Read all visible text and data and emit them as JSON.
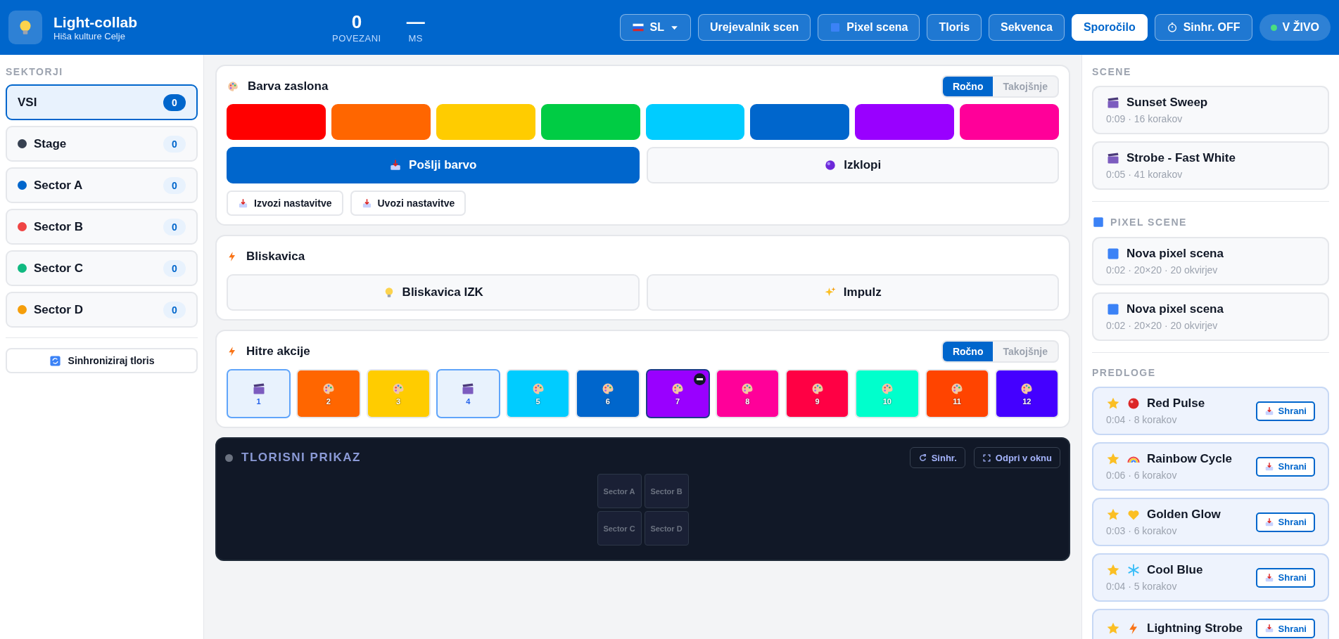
{
  "header": {
    "title": "Light-collab",
    "subtitle": "Hiša kulture Celje",
    "stats": [
      {
        "value": "0",
        "label": "POVEZANI"
      },
      {
        "value": "—",
        "label": "MS"
      }
    ],
    "language": "SL",
    "nav": [
      {
        "label": "Urejevalnik scen",
        "kind": "plain",
        "selected": false
      },
      {
        "label": "Pixel scena",
        "kind": "pixel",
        "selected": false
      },
      {
        "label": "Tloris",
        "kind": "plain",
        "selected": false
      },
      {
        "label": "Sekvenca",
        "kind": "plain",
        "selected": false
      },
      {
        "label": "Sporočilo",
        "kind": "plain",
        "selected": true
      },
      {
        "label": "Sinhr. OFF",
        "kind": "timer",
        "selected": false
      }
    ],
    "live": {
      "label": "V ŽIVO",
      "on": true
    }
  },
  "sectors": {
    "title": "SEKTORJI",
    "items": [
      {
        "name": "VSI",
        "count": "0",
        "selected": true
      },
      {
        "name": "Stage",
        "count": "0",
        "selected": false,
        "color": "#374151"
      },
      {
        "name": "Sector A",
        "count": "0",
        "selected": false,
        "color": "#0066cc"
      },
      {
        "name": "Sector B",
        "count": "0",
        "selected": false,
        "color": "#ef4444"
      },
      {
        "name": "Sector C",
        "count": "0",
        "selected": false,
        "color": "#10b981"
      },
      {
        "name": "Sector D",
        "count": "0",
        "selected": false,
        "color": "#f59e0b"
      }
    ],
    "sync_button": "Sinhroniziraj tloris"
  },
  "screen_color": {
    "title": "Barva zaslona",
    "modes": [
      {
        "label": "Ročno",
        "selected": true
      },
      {
        "label": "Takojšnje",
        "selected": false
      }
    ],
    "swatches": [
      {
        "color": "#ff0000"
      },
      {
        "color": "#ff6600"
      },
      {
        "color": "#ffcc00"
      },
      {
        "color": "#00cc44"
      },
      {
        "color": "#00ccff"
      },
      {
        "color": "#0066cc"
      },
      {
        "color": "#9900ff"
      },
      {
        "color": "#ff0099"
      }
    ],
    "send_button": "Pošlji barvo",
    "off_button": "Izklopi",
    "export_button": "Izvozi nastavitve",
    "import_button": "Uvozi nastavitve"
  },
  "flash": {
    "title": "Bliskavica",
    "buttons": [
      "Bliskavica IZK",
      "Impulz"
    ]
  },
  "quick_actions": {
    "title": "Hitre akcije",
    "modes": [
      {
        "label": "Ročno",
        "selected": true
      },
      {
        "label": "Takojšnje",
        "selected": false
      }
    ],
    "tiles": [
      {
        "kind": "scene",
        "number": "1",
        "selected": false
      },
      {
        "kind": "color",
        "number": "2",
        "color": "#ff6600",
        "selected": false
      },
      {
        "kind": "color",
        "number": "3",
        "color": "#ffcc00",
        "selected": false
      },
      {
        "kind": "scene",
        "number": "4",
        "selected": false
      },
      {
        "kind": "color",
        "number": "5",
        "color": "#00ccff",
        "selected": false
      },
      {
        "kind": "color",
        "number": "6",
        "color": "#0066cc",
        "selected": false
      },
      {
        "kind": "color",
        "number": "7",
        "color": "#9900ff",
        "selected": true
      },
      {
        "kind": "color",
        "number": "8",
        "color": "#ff0099",
        "selected": false
      },
      {
        "kind": "color",
        "number": "9",
        "color": "#ff0044",
        "selected": false
      },
      {
        "kind": "color",
        "number": "10",
        "color": "#00ffcc",
        "selected": false
      },
      {
        "kind": "color",
        "number": "11",
        "color": "#ff4400",
        "selected": false
      },
      {
        "kind": "color",
        "number": "12",
        "color": "#4400ff",
        "selected": false
      }
    ]
  },
  "floor_plan": {
    "title": "TLORISNI PRIKAZ",
    "sync_button": "Sinhr.",
    "open_button": "Odpri v oknu",
    "sectors": [
      "Sector A",
      "Sector B",
      "Sector C",
      "Sector D"
    ]
  },
  "scenes": {
    "title": "SCENE",
    "items": [
      {
        "name": "Sunset Sweep",
        "meta": "0:09 · 16 korakov"
      },
      {
        "name": "Strobe - Fast White",
        "meta": "0:05 · 41 korakov"
      }
    ]
  },
  "pixel_scenes": {
    "title": "PIXEL SCENE",
    "items": [
      {
        "name": "Nova pixel scena",
        "meta": "0:02 · 20×20 · 20 okvirjev"
      },
      {
        "name": "Nova pixel scena",
        "meta": "0:02 · 20×20 · 20 okvirjev"
      }
    ]
  },
  "templates": {
    "title": "PREDLOGE",
    "items": [
      {
        "name": "Red Pulse",
        "meta": "0:04 · 8 korakov",
        "favorite": true,
        "save_button": "Shrani"
      },
      {
        "name": "Rainbow Cycle",
        "meta": "0:06 · 6 korakov",
        "favorite": true,
        "save_button": "Shrani"
      },
      {
        "name": "Golden Glow",
        "meta": "0:03 · 6 korakov",
        "favorite": true,
        "save_button": "Shrani"
      },
      {
        "name": "Cool Blue",
        "meta": "0:04 · 5 korakov",
        "favorite": true,
        "save_button": "Shrani"
      },
      {
        "name": "Lightning Strobe",
        "favorite": true,
        "save_button": "Shrani"
      }
    ]
  }
}
